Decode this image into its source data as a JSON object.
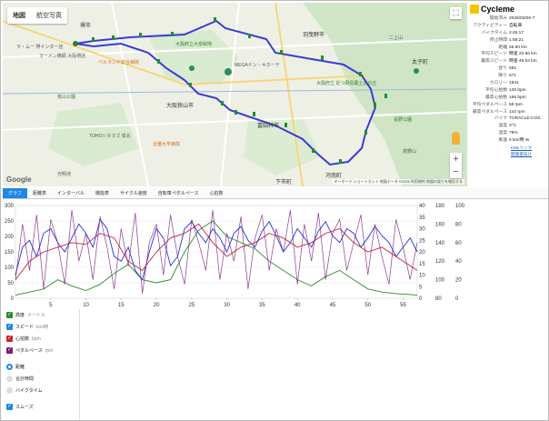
{
  "map": {
    "maptype_buttons": [
      "地図",
      "航空写真"
    ],
    "labels": [
      {
        "t": "堺市",
        "c": "city"
      },
      {
        "t": "ラーメン横綱 大阪堺店",
        "c": ""
      },
      {
        "t": "ベルランド総合病院",
        "c": "orange"
      },
      {
        "t": "大阪府立大泉緑地",
        "c": "green"
      },
      {
        "t": "大阪狭山市",
        "c": "city"
      },
      {
        "t": "近畿大学病院",
        "c": "orange"
      },
      {
        "t": "大阪府立 近つ飛鳥風土記の丘",
        "c": "green"
      },
      {
        "t": "富田林市",
        "c": "city"
      },
      {
        "t": "二上山",
        "c": ""
      },
      {
        "t": "長野公園",
        "c": "green"
      },
      {
        "t": "太子町",
        "c": "city"
      },
      {
        "t": "羽曳野市",
        "c": "city"
      },
      {
        "t": "TOHOシネマズ 泉北",
        "c": ""
      },
      {
        "t": "ラ・ムー 堺インター店",
        "c": ""
      },
      {
        "t": "荒山公園",
        "c": "green"
      },
      {
        "t": "MEGAドン・キホーテ",
        "c": ""
      },
      {
        "t": "光明池",
        "c": ""
      },
      {
        "t": "河南町",
        "c": "city"
      },
      {
        "t": "高野山",
        "c": ""
      },
      {
        "t": "下市町",
        "c": "city"
      }
    ],
    "google_logo": "Google",
    "attribution": "キーボード ショートカット 地図データ ©2025 利用規約 地図の誤りを報告する",
    "route_color": "#3b3bd9"
  },
  "info": {
    "title": "Cycleme",
    "rows": [
      {
        "k": "開始済み",
        "v": "2025/02/09 7:"
      },
      {
        "k": "アクティビティー",
        "v": "自転車"
      },
      {
        "k": "バイクタイム",
        "v": "2:45:17"
      },
      {
        "k": "停止時間",
        "v": "1:59:21"
      },
      {
        "k": "距離",
        "v": "56.90 km"
      },
      {
        "k": "平均スピード",
        "v": "時速 20.66 km"
      },
      {
        "k": "最高スピード",
        "v": "時速 46.64 km"
      },
      {
        "k": "登り",
        "v": "591"
      },
      {
        "k": "降り",
        "v": "571"
      },
      {
        "k": "カロリー",
        "v": "1941"
      },
      {
        "k": "平均心拍数",
        "v": "129 bpm"
      },
      {
        "k": "最高心拍数",
        "v": "166 bpm"
      },
      {
        "k": "平均ペダルペース",
        "v": "58 rpm"
      },
      {
        "k": "最高ペダルペース",
        "v": "142 rpm"
      },
      {
        "k": "バイク",
        "v": "TORACLE-COZ."
      },
      {
        "k": "温度",
        "v": "3°C"
      },
      {
        "k": "湿度",
        "v": "79%"
      },
      {
        "k": "風速",
        "v": "6 km/時 W"
      }
    ],
    "kml_link": "KMLリンク",
    "kml_sub": "開発者向け"
  },
  "tabs": [
    "グラフ",
    "距離表",
    "インターバル",
    "機能表",
    "サイクル速度",
    "自転車ペダルペース",
    "心拍数"
  ],
  "chart_data": {
    "type": "line",
    "x_ticks": [
      5,
      10,
      15,
      20,
      25,
      30,
      35,
      40,
      45,
      50,
      55
    ],
    "xlim": [
      0,
      57
    ],
    "left_axis": {
      "ticks": [
        0,
        50,
        100,
        150,
        200,
        250,
        300
      ],
      "ylim": [
        0,
        300
      ]
    },
    "right_axis1": {
      "ticks": [
        0,
        5,
        10,
        15,
        20,
        25,
        30,
        35,
        40
      ],
      "ylim": [
        0,
        40
      ]
    },
    "right_axis2": {
      "ticks": [
        80,
        100,
        120,
        140,
        160,
        180
      ],
      "ylim": [
        80,
        180
      ]
    },
    "right_axis3": {
      "ticks": [
        0,
        20,
        40,
        60,
        80,
        100
      ],
      "ylim": [
        0,
        100
      ]
    },
    "series": [
      {
        "name": "高度",
        "color": "#2e8b2e",
        "axis": "left",
        "x": [
          0,
          2,
          4,
          6,
          8,
          10,
          12,
          14,
          16,
          18,
          20,
          22,
          24,
          26,
          28,
          30,
          32,
          34,
          36,
          38,
          40,
          42,
          44,
          46,
          48,
          50,
          52,
          54,
          56,
          57
        ],
        "y": [
          10,
          20,
          30,
          60,
          40,
          25,
          45,
          80,
          110,
          60,
          50,
          60,
          150,
          220,
          250,
          200,
          180,
          160,
          120,
          90,
          60,
          40,
          70,
          90,
          60,
          30,
          20,
          15,
          12,
          10
        ]
      },
      {
        "name": "スピード",
        "color": "#2233dd",
        "axis": "right1",
        "x": [
          0,
          1,
          2,
          3,
          4,
          5,
          6,
          7,
          8,
          9,
          10,
          11,
          12,
          13,
          14,
          15,
          16,
          17,
          18,
          19,
          20,
          21,
          22,
          23,
          24,
          25,
          26,
          27,
          28,
          29,
          30,
          31,
          32,
          33,
          34,
          35,
          36,
          37,
          38,
          39,
          40,
          41,
          42,
          43,
          44,
          45,
          46,
          47,
          48,
          49,
          50,
          51,
          52,
          53,
          54,
          55,
          56,
          57
        ],
        "y": [
          10,
          22,
          25,
          18,
          28,
          30,
          24,
          20,
          26,
          32,
          28,
          22,
          34,
          30,
          18,
          16,
          22,
          12,
          8,
          20,
          30,
          26,
          14,
          18,
          30,
          33,
          28,
          24,
          30,
          26,
          20,
          28,
          31,
          25,
          22,
          29,
          33,
          27,
          20,
          24,
          30,
          26,
          22,
          29,
          33,
          27,
          24,
          30,
          28,
          22,
          26,
          31,
          27,
          24,
          18,
          22,
          26,
          20
        ]
      },
      {
        "name": "心拍数",
        "color": "#cc2233",
        "axis": "right2",
        "x": [
          0,
          2,
          4,
          6,
          8,
          10,
          12,
          14,
          16,
          18,
          20,
          22,
          24,
          26,
          28,
          30,
          32,
          34,
          36,
          38,
          40,
          42,
          44,
          46,
          48,
          50,
          52,
          54,
          56,
          57
        ],
        "y": [
          100,
          120,
          130,
          135,
          140,
          138,
          150,
          145,
          120,
          110,
          130,
          145,
          150,
          160,
          140,
          125,
          135,
          140,
          150,
          145,
          135,
          140,
          150,
          155,
          140,
          130,
          135,
          125,
          115,
          110
        ]
      },
      {
        "name": "ペダルペース",
        "color": "#7a1a7a",
        "axis": "right3",
        "x": [
          0,
          1,
          2,
          3,
          4,
          5,
          6,
          7,
          8,
          9,
          10,
          11,
          12,
          13,
          14,
          15,
          16,
          17,
          18,
          19,
          20,
          21,
          22,
          23,
          24,
          25,
          26,
          27,
          28,
          29,
          30,
          31,
          32,
          33,
          34,
          35,
          36,
          37,
          38,
          39,
          40,
          41,
          42,
          43,
          44,
          45,
          46,
          47,
          48,
          49,
          50,
          51,
          52,
          53,
          54,
          55,
          56,
          57
        ],
        "y": [
          20,
          80,
          30,
          90,
          10,
          85,
          60,
          15,
          95,
          40,
          70,
          20,
          88,
          55,
          10,
          75,
          35,
          92,
          5,
          60,
          80,
          25,
          90,
          45,
          15,
          85,
          60,
          30,
          95,
          20,
          70,
          40,
          88,
          10,
          65,
          90,
          30,
          75,
          50,
          95,
          15,
          80,
          40,
          92,
          20,
          70,
          85,
          30,
          60,
          90,
          25,
          80,
          45,
          15,
          85,
          55,
          20,
          60
        ]
      }
    ]
  },
  "legend": {
    "series": [
      {
        "label": "高度",
        "unit": "メートル",
        "color": "#2e8b2e"
      },
      {
        "label": "スピード",
        "unit": "km/時",
        "color": "#1e88e5"
      },
      {
        "label": "心拍数",
        "unit": "bpm",
        "color": "#cc2233"
      },
      {
        "label": "ペダルペース",
        "unit": "rpm",
        "color": "#7a1a7a"
      }
    ],
    "x_options": [
      "距離",
      "合計時間",
      "バイクタイム"
    ],
    "smooth_label": "スムーズ"
  }
}
